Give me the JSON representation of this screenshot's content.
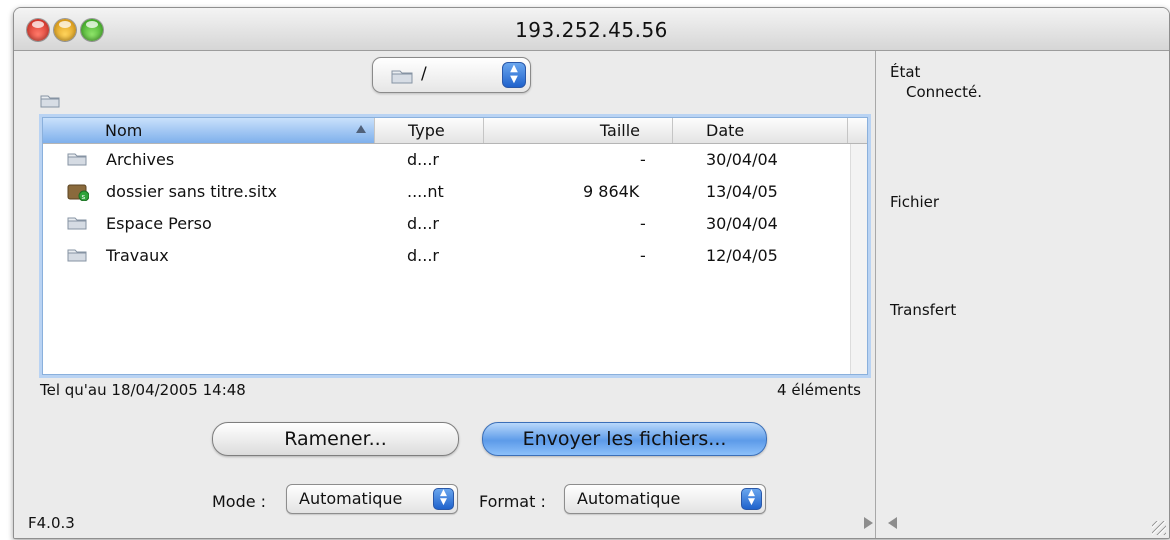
{
  "window": {
    "title": "193.252.45.56"
  },
  "path_popup": {
    "label": "/"
  },
  "columns": {
    "name": "Nom",
    "type": "Type",
    "size": "Taille",
    "date": "Date"
  },
  "files": [
    {
      "name": "Archives",
      "type": "d...r",
      "size": "-",
      "date": "30/04/04",
      "icon": "folder-icon"
    },
    {
      "name": "dossier sans titre.sitx",
      "type": "....nt",
      "size": "9 864K",
      "date": "13/04/05",
      "icon": "archive-icon"
    },
    {
      "name": "Espace Perso",
      "type": "d...r",
      "size": "-",
      "date": "30/04/04",
      "icon": "folder-icon"
    },
    {
      "name": "Travaux",
      "type": "d...r",
      "size": "-",
      "date": "12/04/05",
      "icon": "folder-icon"
    }
  ],
  "status": {
    "updated": "Tel qu'au 18/04/2005 14:48",
    "count": "4 éléments"
  },
  "buttons": {
    "fetch": "Ramener...",
    "send": "Envoyer les fichiers..."
  },
  "mode": {
    "label": "Mode :",
    "value": "Automatique"
  },
  "format": {
    "label": "Format :",
    "value": "Automatique"
  },
  "version": "F4.0.3",
  "side": {
    "state_title": "État",
    "state_value": "Connecté.",
    "file_title": "Fichier",
    "transfer_title": "Transfert"
  },
  "colors": {
    "accent": "#5d9be9",
    "list_focus": "#b9d3f3"
  }
}
